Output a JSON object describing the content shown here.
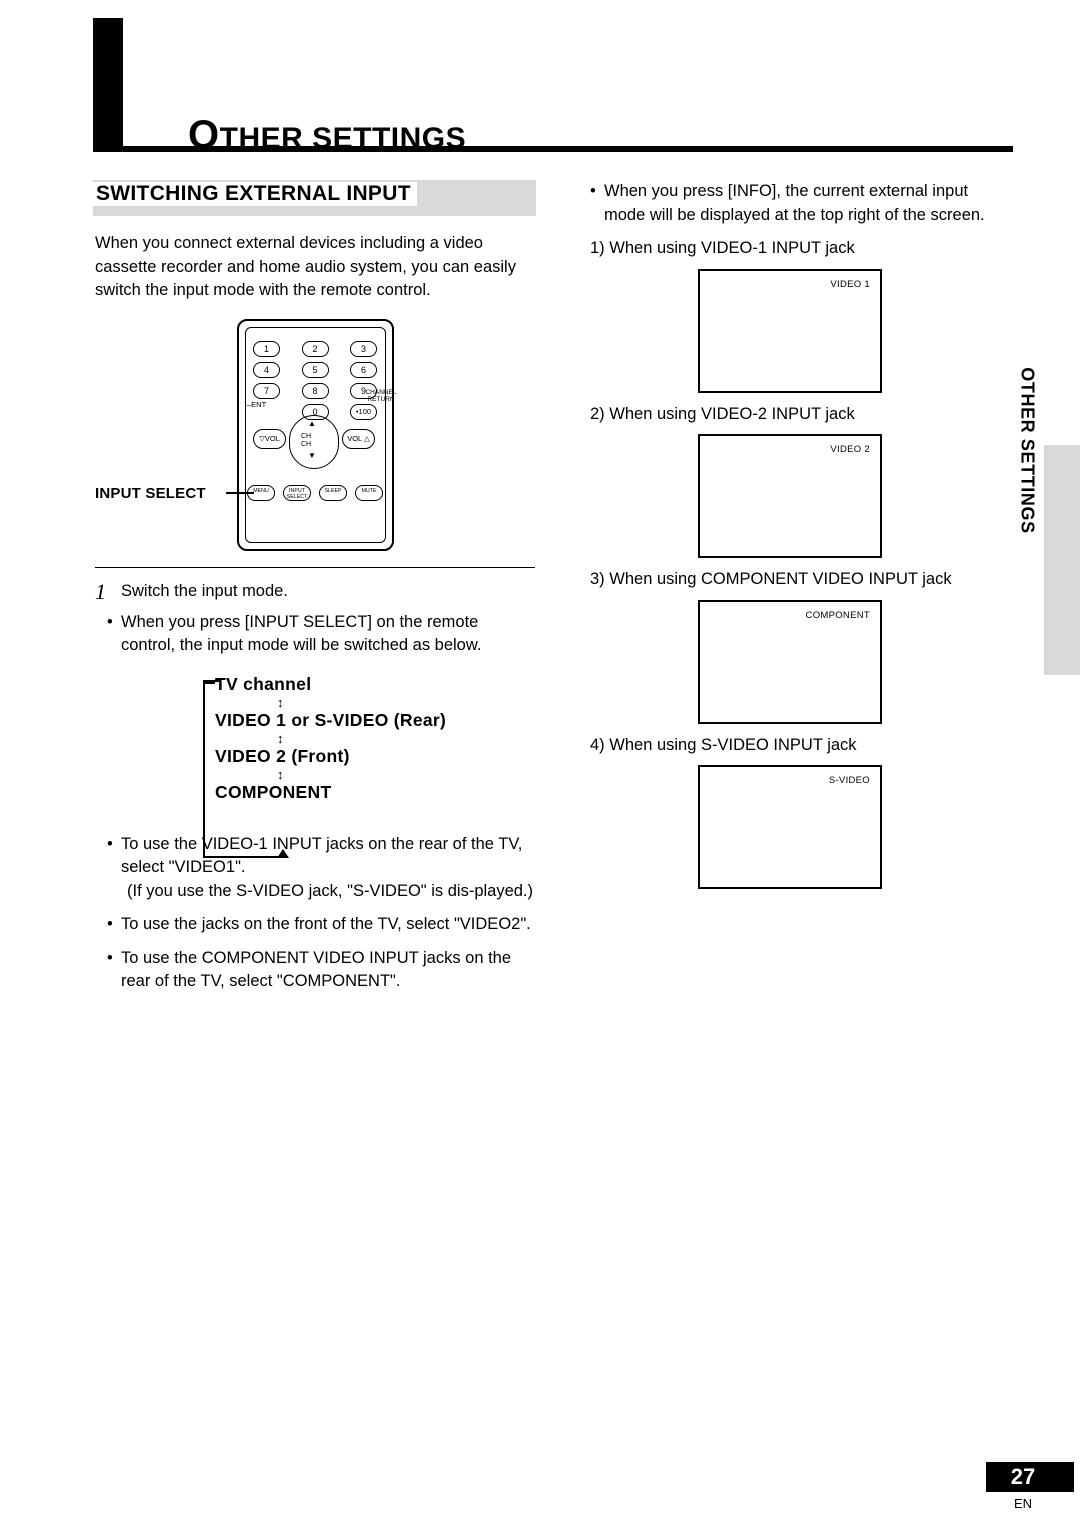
{
  "header": {
    "title_cap": "O",
    "title_rest": "THER SETTINGS"
  },
  "section": {
    "heading": "SWITCHING EXTERNAL INPUT"
  },
  "left": {
    "intro": "When you connect external devices including a video cassette recorder and home audio system, you can easily switch the input mode with the remote control.",
    "remote": {
      "keys": [
        "1",
        "2",
        "3",
        "4",
        "5",
        "6",
        "7",
        "8",
        "9",
        "0"
      ],
      "key_ent": "–ENT",
      "key_100": "•100",
      "channel_return": "CHANNEL\nRETURN",
      "ch_up": "▲",
      "ch_label_top": "CH",
      "ch_label_bottom": "CH",
      "ch_down": "▼",
      "vol_down": "▽VOL",
      "vol_up": "VOL △",
      "buttons": [
        "MENU",
        "INPUT\nSELECT",
        "SLEEP",
        "MUTE"
      ],
      "callout": "INPUT SELECT"
    },
    "step1": {
      "number": "1",
      "text": "Switch the input mode.",
      "bullet": "When you press [INPUT SELECT] on the remote control, the input mode will be switched as below."
    },
    "flow": {
      "items": [
        "TV channel",
        "VIDEO 1 or S-VIDEO (Rear)",
        "VIDEO 2 (Front)",
        "COMPONENT"
      ],
      "arrow": "↕"
    },
    "bullets": [
      "To use the VIDEO-1 INPUT jacks on the rear of the TV, select \"VIDEO1\".",
      "(If you use the S-VIDEO jack, \"S-VIDEO\" is dis-played.)",
      "To use the jacks on the front of the TV, select \"VIDEO2\".",
      "To use the COMPONENT VIDEO INPUT jacks on the rear of the TV, select \"COMPONENT\"."
    ]
  },
  "right": {
    "bullet": "When you press [INFO], the current external input mode will be displayed at the top right of the screen.",
    "items": [
      {
        "num": "1)",
        "text": "When using VIDEO-1 INPUT jack",
        "screen_label": "VIDEO 1"
      },
      {
        "num": "2)",
        "text": "When using VIDEO-2 INPUT jack",
        "screen_label": "VIDEO 2"
      },
      {
        "num": "3)",
        "text": "When using COMPONENT VIDEO INPUT jack",
        "screen_label": "COMPONENT"
      },
      {
        "num": "4)",
        "text": "When using S-VIDEO INPUT jack",
        "screen_label": "S-VIDEO"
      }
    ]
  },
  "side_tab": {
    "label": "OTHER SETTINGS"
  },
  "footer": {
    "page_number": "27",
    "language": "EN"
  },
  "colors": {
    "accent_gray": "#d9d9d9",
    "ink": "#000000"
  }
}
